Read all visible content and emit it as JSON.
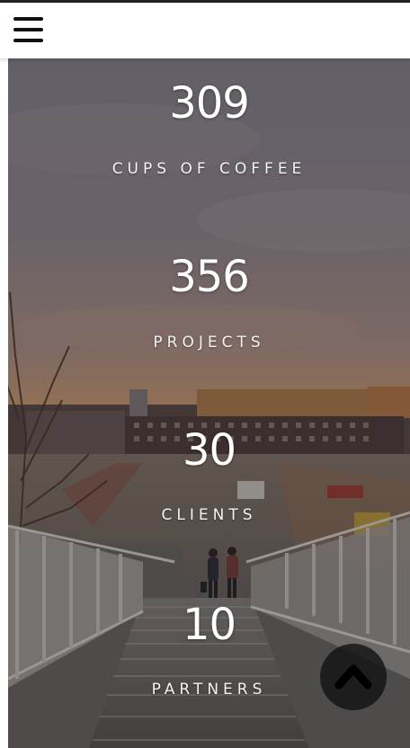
{
  "header": {
    "menu_icon": "hamburger-menu-icon"
  },
  "stats": [
    {
      "number": "309",
      "label": "CUPS OF COFFEE"
    },
    {
      "number": "356",
      "label": "PROJECTS"
    },
    {
      "number": "30",
      "label": "CLIENTS"
    },
    {
      "number": "10",
      "label": "PARTNERS"
    }
  ],
  "scroll_top": {
    "icon": "chevron-up-icon"
  },
  "colors": {
    "header_bg": "#ffffff",
    "top_border": "#222222",
    "stat_text": "#ffffff",
    "scroll_button_bg": "#141414"
  }
}
